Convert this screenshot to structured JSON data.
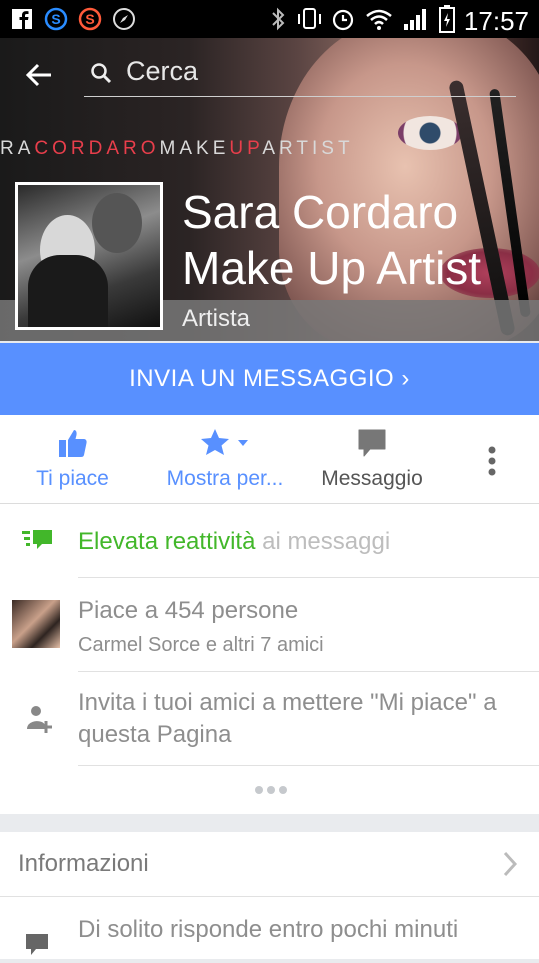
{
  "statusbar": {
    "time": "17:57"
  },
  "search": {
    "placeholder": "Cerca"
  },
  "banner": {
    "prefix": "RA",
    "part1": "CORDARO",
    "part2": "MAKE",
    "part3": "UP",
    "part4": "ARTIST"
  },
  "page": {
    "title": "Sara Cordaro Make Up Artist",
    "category": "Artista"
  },
  "message_button": {
    "label": "INVIA UN MESSAGGIO ›"
  },
  "actions": {
    "like": "Ti piace",
    "show": "Mostra per...",
    "message": "Messaggio"
  },
  "responsiveness": {
    "highlight": "Elevata reattività",
    "rest": " ai messaggi"
  },
  "likes": {
    "count_text": "Piace a 454 persone",
    "friends_text": "Carmel Sorce e altri 7 amici"
  },
  "invite": {
    "text": "Invita i tuoi amici a mettere \"Mi piace\" a questa Pagina"
  },
  "info": {
    "header": "Informazioni",
    "response_time": "Di solito risponde entro pochi minuti"
  },
  "colors": {
    "accent": "#5890ff",
    "green": "#42b72a"
  }
}
